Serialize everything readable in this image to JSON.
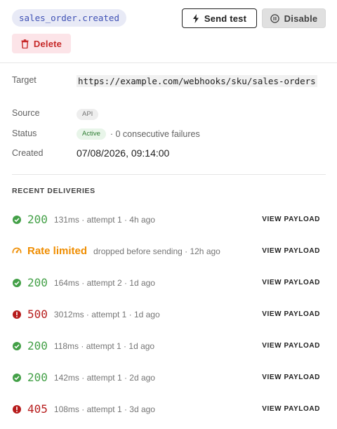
{
  "header": {
    "event_name": "sales_order.created",
    "send_test_label": "Send test",
    "disable_label": "Disable",
    "delete_label": "Delete"
  },
  "details": {
    "target_label": "Target",
    "target_value": "https://example.com/webhooks/sku/sales-orders",
    "source_label": "Source",
    "source_value": "API",
    "status_label": "Status",
    "status_value": "Active",
    "status_extra": "· 0 consecutive failures",
    "created_label": "Created",
    "created_value": "07/08/2026, 09:14:00"
  },
  "deliveries": {
    "title": "RECENT DELIVERIES",
    "view_label": "VIEW PAYLOAD",
    "items": [
      {
        "code": "200",
        "meta": "131ms · attempt 1 · 4h ago"
      },
      {
        "code": "Rate limited",
        "meta": "dropped before sending · 12h ago"
      },
      {
        "code": "200",
        "meta": "164ms · attempt 2 · 1d ago"
      },
      {
        "code": "500",
        "meta": "3012ms · attempt 1 · 1d ago"
      },
      {
        "code": "200",
        "meta": "118ms · attempt 1 · 1d ago"
      },
      {
        "code": "200",
        "meta": "142ms · attempt 1 · 2d ago"
      },
      {
        "code": "405",
        "meta": "108ms · attempt 1 · 3d ago"
      }
    ]
  },
  "colors": {
    "success": "#43a047",
    "error": "#b71c1c",
    "warning": "#ef8d00",
    "accent": "#3f51b5"
  }
}
